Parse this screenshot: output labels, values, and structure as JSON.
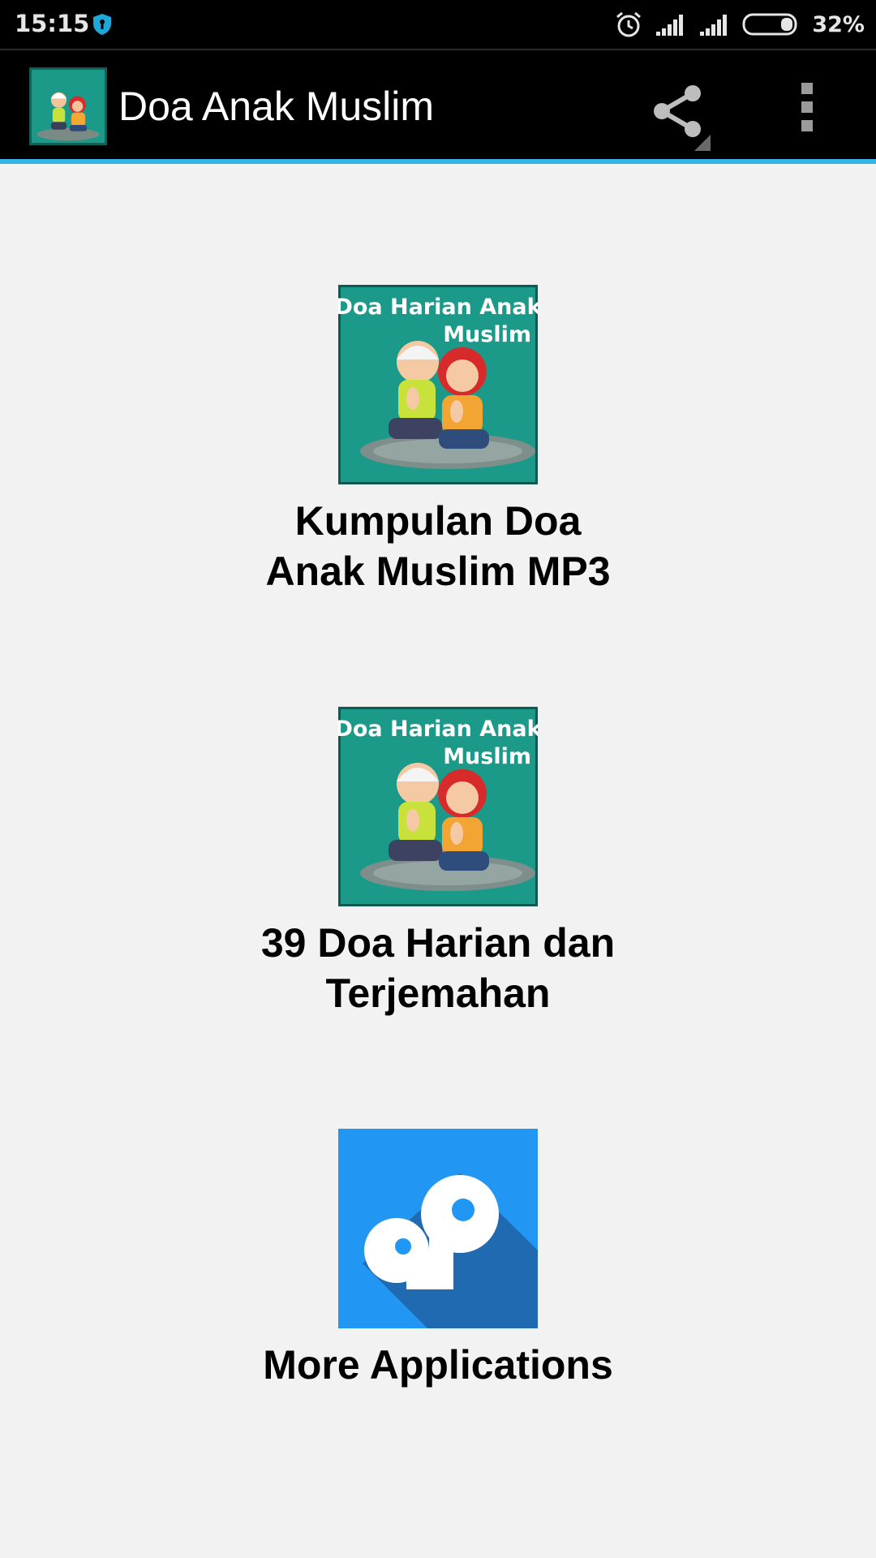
{
  "status_bar": {
    "time": "15:15",
    "battery_percent": "32%",
    "icons": [
      "shield-icon",
      "alarm-icon",
      "signal-1-icon",
      "signal-2-icon",
      "battery-icon"
    ],
    "battery_level": 0.32
  },
  "app_bar": {
    "title": "Doa Anak Muslim",
    "icons": [
      "app-logo",
      "share-icon",
      "overflow-menu-icon"
    ],
    "accent_color": "#33b5e5"
  },
  "thumbnail": {
    "line1": "Doa Harian Anak",
    "line2": "Muslim"
  },
  "menu": {
    "items": [
      {
        "label": "Kumpulan Doa\nAnak Muslim MP3",
        "icon": "kids-praying-image"
      },
      {
        "label": "39 Doa Harian dan\nTerjemahan",
        "icon": "kids-praying-image"
      },
      {
        "label": "More Applications",
        "icon": "more-apps-logo"
      }
    ]
  },
  "colors": {
    "thumbnail_bg": "#1b9a8a",
    "more_apps_bg": "#2196f3",
    "more_apps_shadow": "#1f6ab0"
  }
}
